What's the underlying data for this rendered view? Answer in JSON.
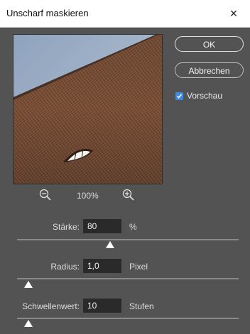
{
  "window": {
    "title": "Unscharf maskieren",
    "close_glyph": "×"
  },
  "buttons": {
    "ok": "OK",
    "cancel": "Abbrechen"
  },
  "preview_option": {
    "label": "Vorschau",
    "checked": true
  },
  "zoom": {
    "value": "100%",
    "zoom_out_icon": "zoom-out-icon",
    "zoom_in_icon": "zoom-in-icon"
  },
  "params": {
    "staerke": {
      "label": "Stärke:",
      "value": "80",
      "unit": "%",
      "slider_fraction": 0.42
    },
    "radius": {
      "label": "Radius:",
      "value": "1,0",
      "unit": "Pixel",
      "slider_fraction": 0.05
    },
    "schwelle": {
      "label": "Schwellenwert:",
      "value": "10",
      "unit": "Stufen",
      "slider_fraction": 0.05
    }
  },
  "colors": {
    "background": "#535353",
    "checkbox": "#3d89e3",
    "titlebar": "#ffffff"
  }
}
